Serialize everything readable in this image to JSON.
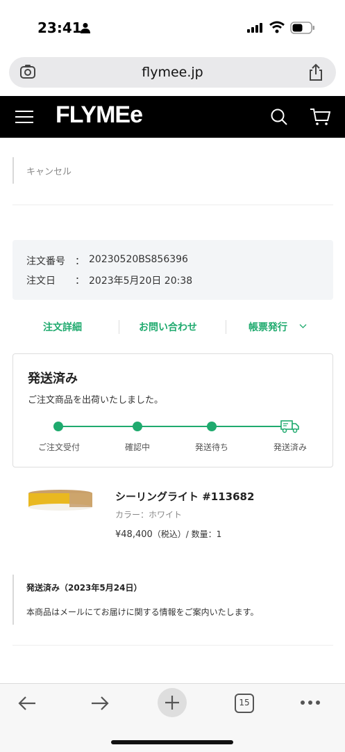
{
  "status_bar": {
    "time": "23:41"
  },
  "browser": {
    "url": "flymee.jp",
    "tabs_count": "15"
  },
  "header": {
    "logo": "FLYMEe"
  },
  "cancel": {
    "label": "キャンセル"
  },
  "order": {
    "number_label": "注文番号",
    "number_sep": "：",
    "number_value": "20230520BS856396",
    "date_label": "注文日",
    "date_sep": "：",
    "date_value": "2023年5月20日 20:38"
  },
  "actions": {
    "details": "注文詳細",
    "inquiry": "お問い合わせ",
    "invoice": "帳票発行"
  },
  "shipping_status": {
    "title": "発送済み",
    "description": "ご注文商品を出荷いたしました。",
    "steps": [
      "ご注文受付",
      "確認中",
      "発送待ち",
      "発送済み"
    ]
  },
  "product": {
    "name": "シーリングライト #113682",
    "color": "カラー：ホワイト",
    "price": "¥48,400",
    "tax": "（税込）",
    "quantity": "/  数量：1"
  },
  "shipped_note": {
    "title": "発送済み（2023年5月24日）",
    "text": "本商品はメールにてお届けに関する情報をご案内いたします。"
  },
  "colors": {
    "accent": "#1faa6e",
    "header_bg": "#000000"
  }
}
